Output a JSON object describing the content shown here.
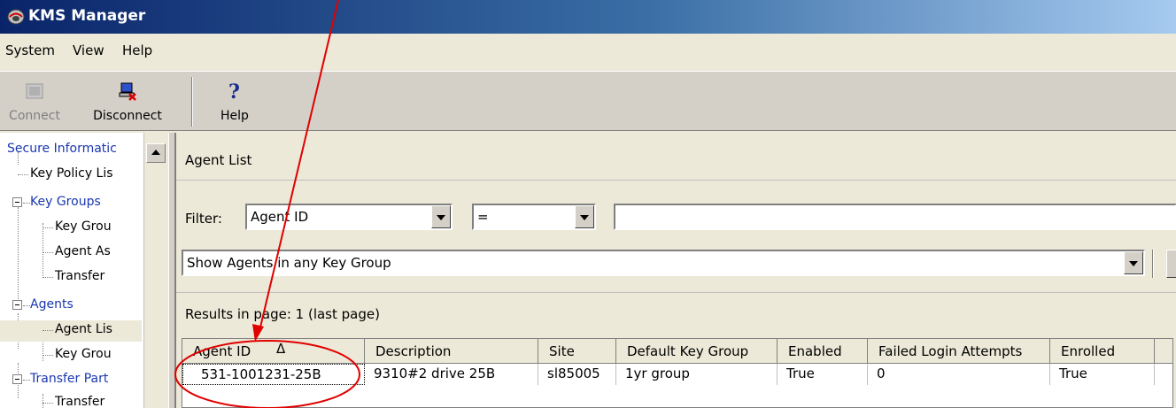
{
  "window": {
    "title": "KMS Manager"
  },
  "menu": [
    "System",
    "View",
    "Help"
  ],
  "toolbar": {
    "connect_label": "Connect",
    "disconnect_label": "Disconnect",
    "help_label": "Help"
  },
  "tree": {
    "items": [
      {
        "label": "Secure Informatic",
        "link": true
      },
      {
        "label": "Key Policy Lis",
        "link": false
      },
      {
        "label": "Key Groups",
        "link": true
      },
      {
        "label": "Key Grou",
        "link": false
      },
      {
        "label": "Agent As",
        "link": false
      },
      {
        "label": "Transfer",
        "link": false
      },
      {
        "label": "Agents",
        "link": true
      },
      {
        "label": "Agent Lis",
        "link": false
      },
      {
        "label": "Key Grou",
        "link": false
      },
      {
        "label": "Transfer Part",
        "link": true
      },
      {
        "label": "Transfer",
        "link": false
      }
    ]
  },
  "pane": {
    "title": "Agent List",
    "filter_label": "Filter:",
    "filter_field": "Agent ID",
    "filter_operator": "=",
    "filter_value": "",
    "key_group_filter": "Show Agents in any Key Group",
    "results_label": "Results in page: 1 (last page)"
  },
  "grid": {
    "columns": [
      "Agent ID",
      "Description",
      "Site",
      "Default Key Group",
      "Enabled",
      "Failed Login Attempts",
      "Enrolled"
    ],
    "sort_indicator": "Δ",
    "rows": [
      [
        "531-1001231-25B",
        "9310#2 drive 25B",
        "sl85005",
        "1yr group",
        "True",
        "0",
        "True"
      ]
    ]
  },
  "annotation": {
    "color": "#e00000"
  }
}
